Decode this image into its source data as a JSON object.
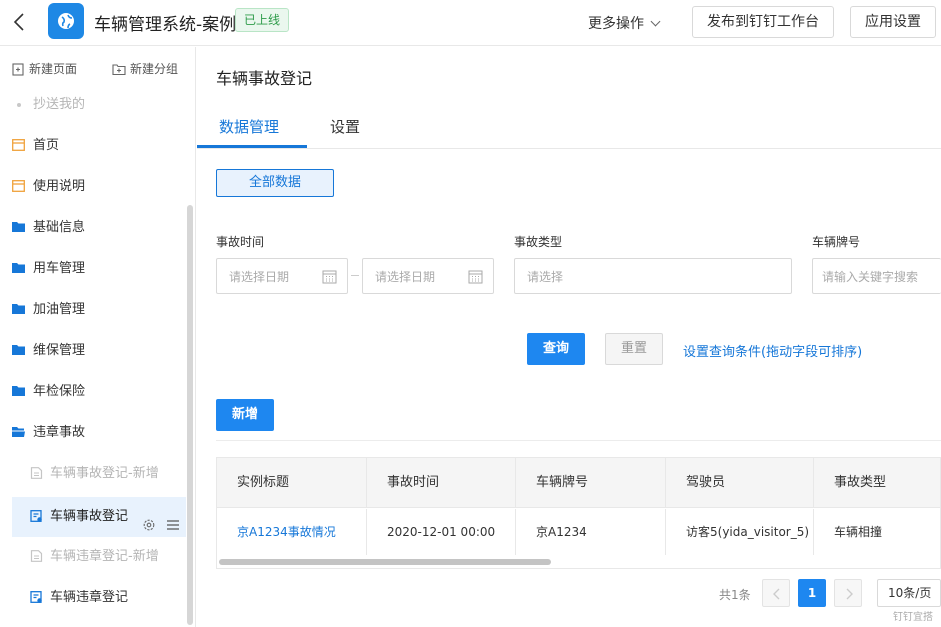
{
  "header": {
    "app_title": "车辆管理系统-案例",
    "status_badge": "已上线",
    "more_actions": "更多操作",
    "publish_button": "发布到钉钉工作台",
    "settings_button": "应用设置"
  },
  "sidebar": {
    "new_page": "新建页面",
    "new_group": "新建分组",
    "items": [
      {
        "label": "抄送我的"
      },
      {
        "label": "首页"
      },
      {
        "label": "使用说明"
      },
      {
        "label": "基础信息"
      },
      {
        "label": "用车管理"
      },
      {
        "label": "加油管理"
      },
      {
        "label": "维保管理"
      },
      {
        "label": "年检保险"
      },
      {
        "label": "违章事故"
      },
      {
        "label": "车辆事故登记-新增"
      },
      {
        "label": "车辆事故登记"
      },
      {
        "label": "车辆违章登记-新增"
      },
      {
        "label": "车辆违章登记"
      }
    ]
  },
  "main": {
    "page_title": "车辆事故登记",
    "tabs": [
      {
        "label": "数据管理"
      },
      {
        "label": "设置"
      }
    ],
    "all_data_button": "全部数据",
    "filters": {
      "accident_time_label": "事故时间",
      "date_start_placeholder": "请选择日期",
      "date_end_placeholder": "请选择日期",
      "accident_type_label": "事故类型",
      "accident_type_placeholder": "请选择",
      "plate_label": "车辆牌号",
      "plate_placeholder": "请输入关键字搜索"
    },
    "query_button": "查询",
    "reset_button": "重置",
    "query_settings_link": "设置查询条件(拖动字段可排序)",
    "add_button": "新增",
    "table": {
      "columns": [
        "实例标题",
        "事故时间",
        "车辆牌号",
        "驾驶员",
        "事故类型"
      ],
      "rows": [
        [
          "京A1234事故情况",
          "2020-12-01 00:00",
          "京A1234",
          "访客5(yida_visitor_5)",
          "车辆相撞"
        ]
      ]
    },
    "pagination": {
      "total": "共1条",
      "current_page": "1",
      "page_size": "10条/页"
    },
    "watermark": "钉钉宜搭"
  },
  "colors": {
    "primary": "#1e87f0",
    "link": "#1677d8",
    "active_bg": "#e8f2fd",
    "badge_green": "#2e9c4a",
    "folder_blue": "#1677d8",
    "page_orange": "#f0a23b"
  }
}
